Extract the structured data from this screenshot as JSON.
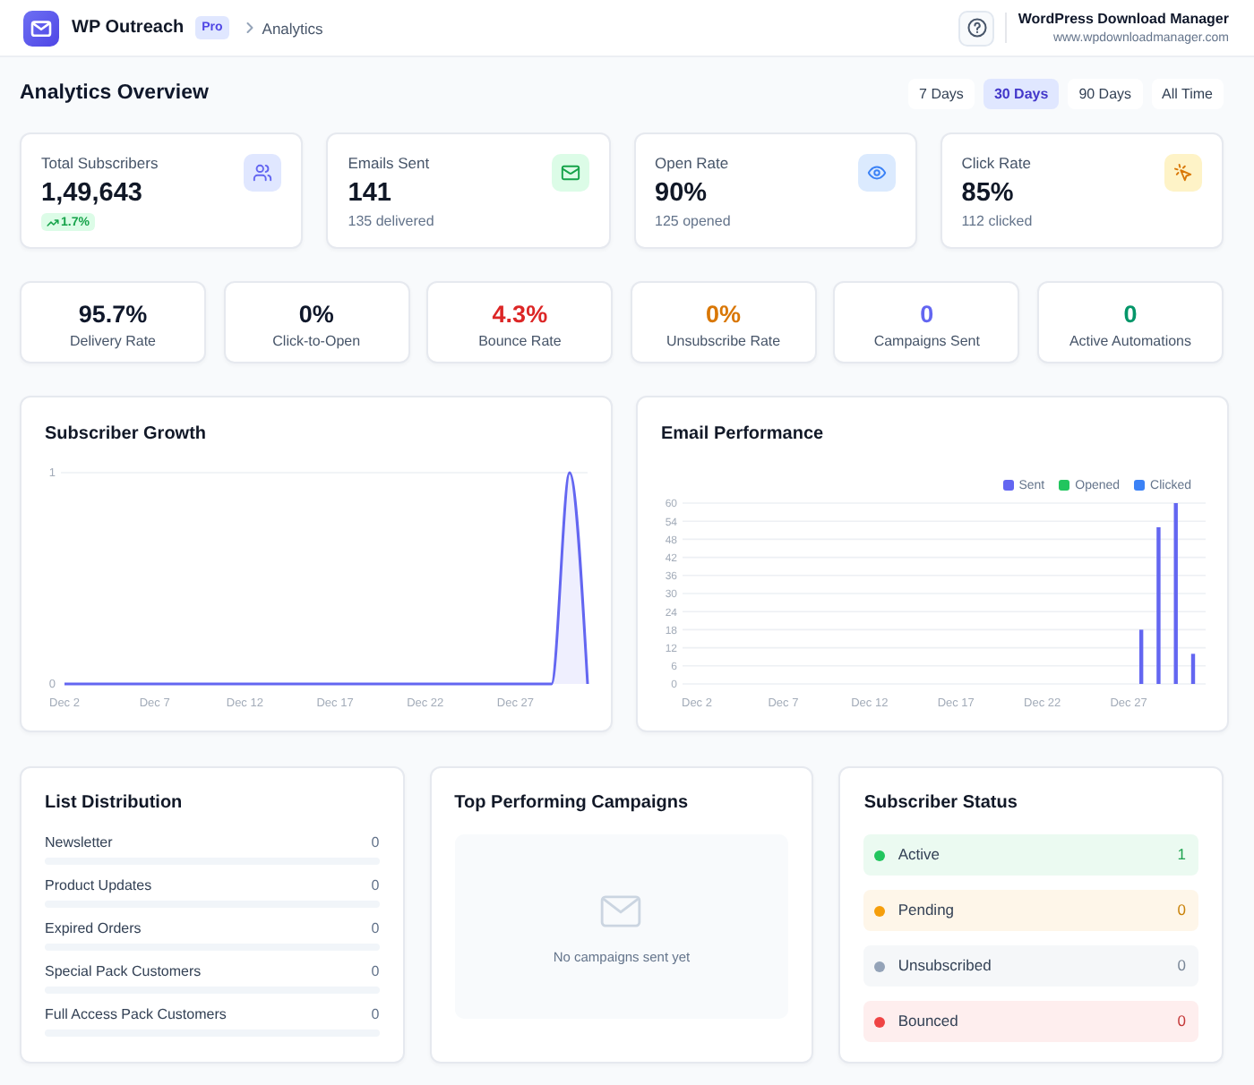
{
  "header": {
    "app_name": "WP Outreach",
    "plan": "Pro",
    "breadcrumb": "Analytics",
    "site_name": "WordPress Download Manager",
    "site_url": "www.wpdownloadmanager.com"
  },
  "overview": {
    "title": "Analytics Overview",
    "ranges": [
      {
        "label": "7 Days",
        "selected": false
      },
      {
        "label": "30 Days",
        "selected": true
      },
      {
        "label": "90 Days",
        "selected": false
      },
      {
        "label": "All Time",
        "selected": false
      }
    ]
  },
  "stat_cards": [
    {
      "label": "Total Subscribers",
      "value": "1,49,643",
      "change": "1.7%",
      "color": "#e0e7ff"
    },
    {
      "label": "Emails Sent",
      "value": "141",
      "detail": "135 delivered",
      "color": "#dcfce7"
    },
    {
      "label": "Open Rate",
      "value": "90%",
      "detail": "125 opened",
      "color": "#dbeafe"
    },
    {
      "label": "Click Rate",
      "value": "85%",
      "detail": "112 clicked",
      "color": "#fef3c7"
    }
  ],
  "metrics": [
    {
      "value": "95.7%",
      "label": "Delivery Rate",
      "color": "#0f172a"
    },
    {
      "value": "0%",
      "label": "Click-to-Open",
      "color": "#0f172a"
    },
    {
      "value": "4.3%",
      "label": "Bounce Rate",
      "color": "#dc2626"
    },
    {
      "value": "0%",
      "label": "Unsubscribe Rate",
      "color": "#d97706"
    },
    {
      "value": "0",
      "label": "Campaigns Sent",
      "color": "#6366f1"
    },
    {
      "value": "0",
      "label": "Active Automations",
      "color": "#059669"
    }
  ],
  "subscriber_growth": {
    "chart_data": {
      "type": "area",
      "title": "Subscriber Growth",
      "categories": [
        "Dec 2",
        null,
        null,
        null,
        null,
        "Dec 7",
        null,
        null,
        null,
        null,
        "Dec 12",
        null,
        null,
        null,
        null,
        "Dec 17",
        null,
        null,
        null,
        null,
        "Dec 22",
        null,
        null,
        null,
        null,
        "Dec 27",
        null,
        null,
        null,
        null
      ],
      "values": [
        0,
        0,
        0,
        0,
        0,
        0,
        0,
        0,
        0,
        0,
        0,
        0,
        0,
        0,
        0,
        0,
        0,
        0,
        0,
        0,
        0,
        0,
        0,
        0,
        0,
        0,
        0,
        0,
        1,
        0
      ],
      "ylim": [
        0,
        1
      ],
      "yticks": [
        0,
        1
      ],
      "grid": true
    }
  },
  "email_performance": {
    "chart_data": {
      "type": "bar",
      "title": "Email Performance",
      "categories": [
        "Dec 2",
        null,
        null,
        null,
        null,
        "Dec 7",
        null,
        null,
        null,
        null,
        "Dec 12",
        null,
        null,
        null,
        null,
        "Dec 17",
        null,
        null,
        null,
        null,
        "Dec 22",
        null,
        null,
        null,
        null,
        "Dec 27",
        null,
        null,
        null,
        null
      ],
      "series": [
        {
          "name": "Sent",
          "color": "#6366f1",
          "values": [
            0,
            0,
            0,
            0,
            0,
            0,
            0,
            0,
            0,
            0,
            0,
            0,
            0,
            0,
            0,
            0,
            0,
            0,
            0,
            0,
            0,
            0,
            0,
            0,
            0,
            0,
            18,
            52,
            60,
            10
          ]
        },
        {
          "name": "Opened",
          "color": "#22c55e",
          "values": [
            0,
            0,
            0,
            0,
            0,
            0,
            0,
            0,
            0,
            0,
            0,
            0,
            0,
            0,
            0,
            0,
            0,
            0,
            0,
            0,
            0,
            0,
            0,
            0,
            0,
            0,
            0,
            0,
            0,
            0
          ]
        },
        {
          "name": "Clicked",
          "color": "#3b82f6",
          "values": [
            0,
            0,
            0,
            0,
            0,
            0,
            0,
            0,
            0,
            0,
            0,
            0,
            0,
            0,
            0,
            0,
            0,
            0,
            0,
            0,
            0,
            0,
            0,
            0,
            0,
            0,
            0,
            0,
            0,
            0
          ]
        }
      ],
      "ylim": [
        0,
        60
      ],
      "yticks": [
        0,
        6,
        12,
        18,
        24,
        30,
        36,
        42,
        48,
        54,
        60
      ],
      "grid": true
    }
  },
  "list_distribution": {
    "title": "List Distribution",
    "lists": [
      {
        "name": "Newsletter",
        "count": "0",
        "level": 0
      },
      {
        "name": "Product Updates",
        "count": "0",
        "level": 0
      },
      {
        "name": "Expired Orders",
        "count": "0",
        "level": 0
      },
      {
        "name": "Special Pack Customers",
        "count": "0",
        "level": 0
      },
      {
        "name": "Full Access Pack Customers",
        "count": "0",
        "level": 0
      }
    ]
  },
  "top_campaigns": {
    "title": "Top Performing Campaigns",
    "empty_message": "No campaigns sent yet"
  },
  "subscriber_status": {
    "title": "Subscriber Status",
    "statuses": [
      {
        "label": "Active",
        "count": "1",
        "color": "#22c55e"
      },
      {
        "label": "Pending",
        "count": "0",
        "color": "#f59e0b"
      },
      {
        "label": "Unsubscribed",
        "count": "0",
        "color": "#94a3b8"
      },
      {
        "label": "Bounced",
        "count": "0",
        "color": "#ef4444"
      }
    ]
  }
}
